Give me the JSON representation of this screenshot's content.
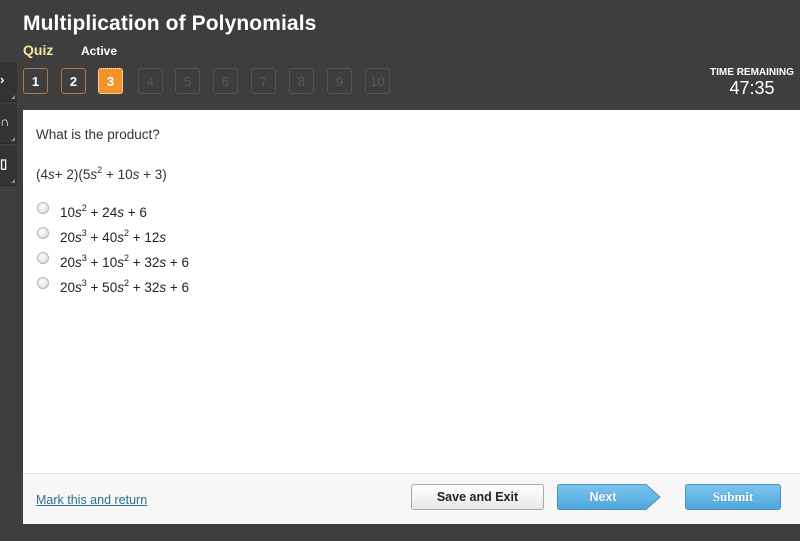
{
  "header": {
    "title": "Multiplication of Polynomials",
    "type_label": "Quiz",
    "status_label": "Active"
  },
  "question_nav": [
    {
      "label": "1",
      "state": "answered"
    },
    {
      "label": "2",
      "state": "answered"
    },
    {
      "label": "3",
      "state": "current"
    },
    {
      "label": "4",
      "state": "locked"
    },
    {
      "label": "5",
      "state": "locked"
    },
    {
      "label": "6",
      "state": "locked"
    },
    {
      "label": "7",
      "state": "locked"
    },
    {
      "label": "8",
      "state": "locked"
    },
    {
      "label": "9",
      "state": "locked"
    },
    {
      "label": "10",
      "state": "locked"
    }
  ],
  "timer": {
    "label": "TIME REMAINING",
    "value": "47:35"
  },
  "side_tabs": [
    {
      "icon": "arrow-right-icon",
      "glyph": "›"
    },
    {
      "icon": "headphones-icon",
      "glyph": "∩"
    },
    {
      "icon": "notepad-icon",
      "glyph": "▯"
    }
  ],
  "question": {
    "prompt": "What is the product?",
    "expression": [
      {
        "t": "(4"
      },
      {
        "i": "s"
      },
      {
        "t": "+ 2)(5"
      },
      {
        "i": "s"
      },
      {
        "sup": "2"
      },
      {
        "t": " + 10"
      },
      {
        "i": "s"
      },
      {
        "t": " + 3)"
      }
    ],
    "options": [
      {
        "parts": [
          {
            "t": "10"
          },
          {
            "i": "s"
          },
          {
            "sup": "2"
          },
          {
            "t": " + 24"
          },
          {
            "i": "s"
          },
          {
            "t": " + 6"
          }
        ],
        "selected": false
      },
      {
        "parts": [
          {
            "t": "20"
          },
          {
            "i": "s"
          },
          {
            "sup": "3"
          },
          {
            "t": " + 40"
          },
          {
            "i": "s"
          },
          {
            "sup": "2"
          },
          {
            "t": " + 12"
          },
          {
            "i": "s"
          }
        ],
        "selected": false
      },
      {
        "parts": [
          {
            "t": "20"
          },
          {
            "i": "s"
          },
          {
            "sup": "3"
          },
          {
            "t": " + 10"
          },
          {
            "i": "s"
          },
          {
            "sup": "2"
          },
          {
            "t": " + 32"
          },
          {
            "i": "s"
          },
          {
            "t": " + 6"
          }
        ],
        "selected": false
      },
      {
        "parts": [
          {
            "t": "20"
          },
          {
            "i": "s"
          },
          {
            "sup": "3"
          },
          {
            "t": " + 50"
          },
          {
            "i": "s"
          },
          {
            "sup": "2"
          },
          {
            "t": " + 32"
          },
          {
            "i": "s"
          },
          {
            "t": " + 6"
          }
        ],
        "selected": false
      }
    ]
  },
  "footer": {
    "mark_link": "Mark this and return",
    "save_label": "Save and Exit",
    "next_label": "Next",
    "submit_label": "Submit"
  },
  "colors": {
    "background": "#3e3e3e",
    "accent_orange": "#f39227",
    "quiz_label": "#f3e2a3",
    "button_blue": "#5fb3e3",
    "link": "#2e6f8e"
  }
}
